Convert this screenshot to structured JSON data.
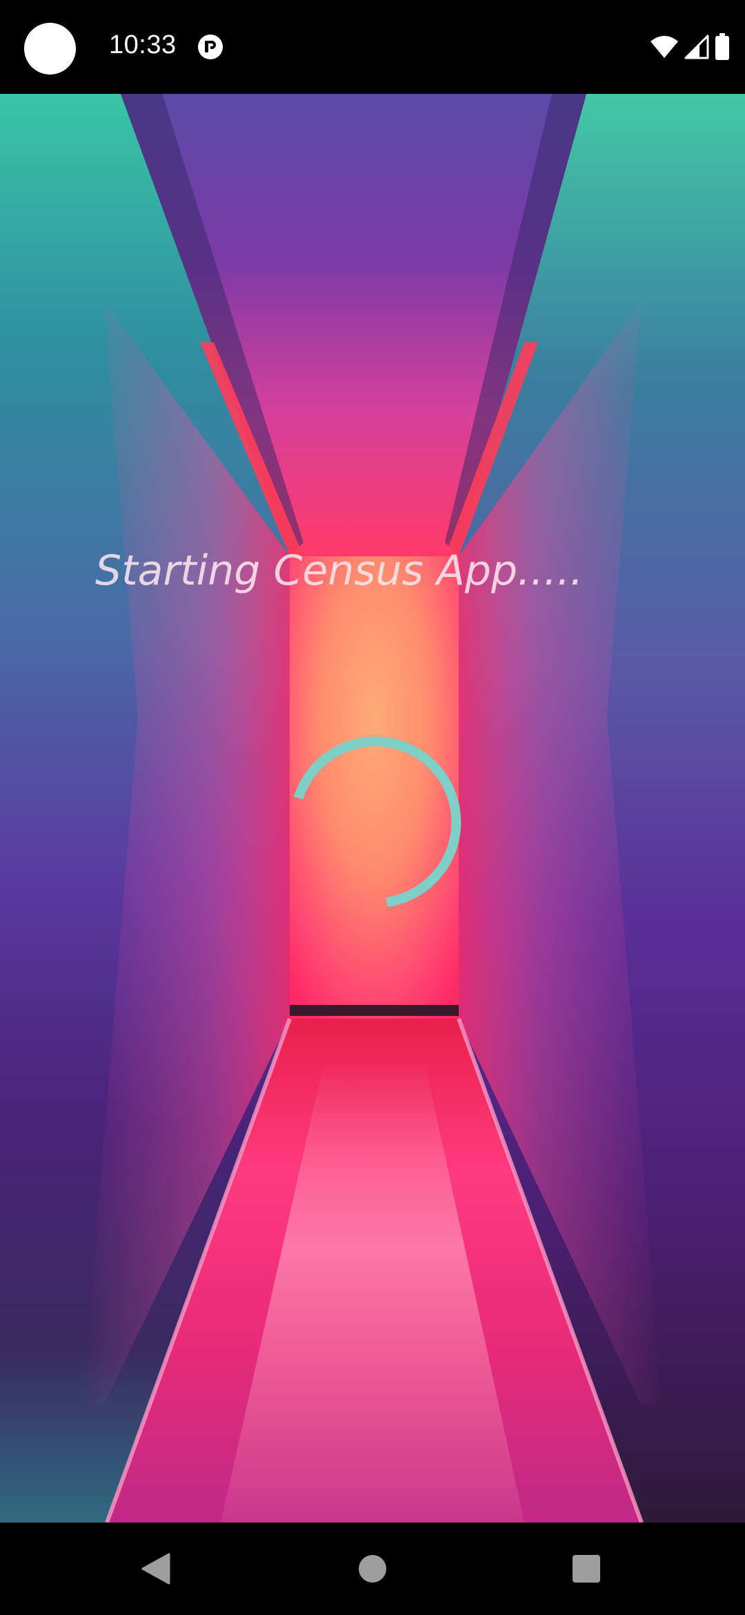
{
  "status_bar": {
    "time": "10:33",
    "notification_icon": "app-notification-icon",
    "wifi_icon": "wifi-icon",
    "signal_icon": "cell-signal-icon",
    "battery_icon": "battery-icon"
  },
  "splash": {
    "loading_text": "Starting Census App.....",
    "spinner_color": "#7ECFC8",
    "background_image": "neon-hallway-image"
  },
  "nav_bar": {
    "back_icon": "back-triangle-icon",
    "home_icon": "home-circle-icon",
    "recents_icon": "recents-square-icon",
    "icon_color": "#9E9E9E"
  }
}
